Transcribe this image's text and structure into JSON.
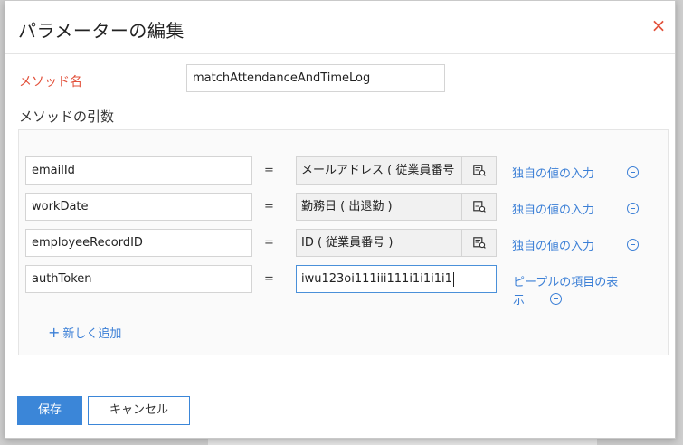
{
  "dialog": {
    "title": "パラメーターの編集",
    "close_glyph": "×"
  },
  "method": {
    "label": "メソッド名",
    "value": "matchAttendanceAndTimeLog"
  },
  "args": {
    "heading": "メソッドの引数",
    "equals": "=",
    "rows": [
      {
        "name": "emailId",
        "value": "メールアドレス ( 従業員番号",
        "link": "独自の値の入力"
      },
      {
        "name": "workDate",
        "value": "勤務日 ( 出退勤 )",
        "link": "独自の値の入力"
      },
      {
        "name": "employeeRecordID",
        "value": "ID ( 従業員番号 )",
        "link": "独自の値の入力"
      },
      {
        "name": "authToken",
        "value": "iwu123oi111iii111i1i1i1i1",
        "link_line1": "ピープルの項目の表",
        "link_line2": "示"
      }
    ],
    "add_label": "新しく追加",
    "add_glyph": "+"
  },
  "footer": {
    "save_label": "保存",
    "cancel_label": "キャンセル"
  },
  "colors": {
    "accent": "#3b86d8",
    "label_red": "#e2513b"
  }
}
